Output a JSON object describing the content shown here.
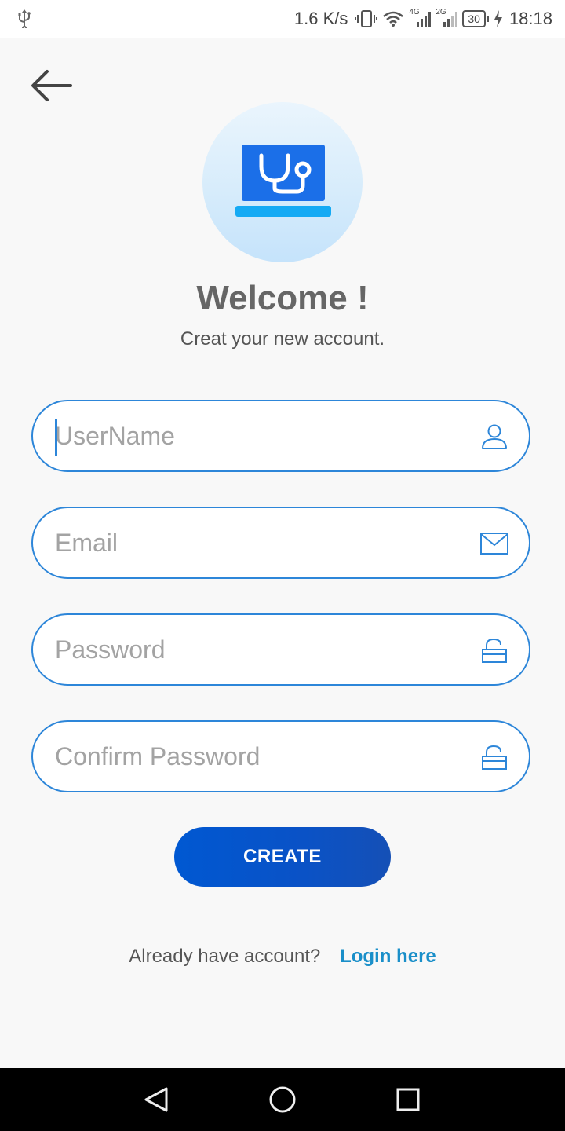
{
  "status_bar": {
    "net_speed": "1.6 K/s",
    "net_type_1": "4G",
    "net_type_2": "2G",
    "battery": "30",
    "time": "18:18",
    "icons": [
      "usb-icon",
      "vibrate-icon",
      "wifi-icon",
      "signal-icon",
      "signal-icon",
      "battery-icon",
      "charging-icon"
    ]
  },
  "header": {
    "back_icon": "arrow-left-icon"
  },
  "logo": {
    "icon": "laptop-stethoscope-icon"
  },
  "welcome": {
    "title": "Welcome !",
    "subtitle": "Creat your new account."
  },
  "form": {
    "username": {
      "placeholder": "UserName",
      "value": "",
      "icon": "user-icon"
    },
    "email": {
      "placeholder": "Email",
      "value": "",
      "icon": "mail-icon"
    },
    "password": {
      "placeholder": "Password",
      "value": "",
      "icon": "lock-icon"
    },
    "confirm_password": {
      "placeholder": "Confirm Password",
      "value": "",
      "icon": "lock-icon"
    },
    "create_label": "CREATE"
  },
  "footer": {
    "prompt": "Already have account?",
    "login_link": "Login here"
  },
  "nav": {
    "icons": [
      "back-triangle-icon",
      "home-circle-icon",
      "recents-square-icon"
    ]
  },
  "colors": {
    "accent": "#2d86d9",
    "button": "#0a52c6",
    "link": "#1a8fc9",
    "background": "#f8f8f8"
  }
}
